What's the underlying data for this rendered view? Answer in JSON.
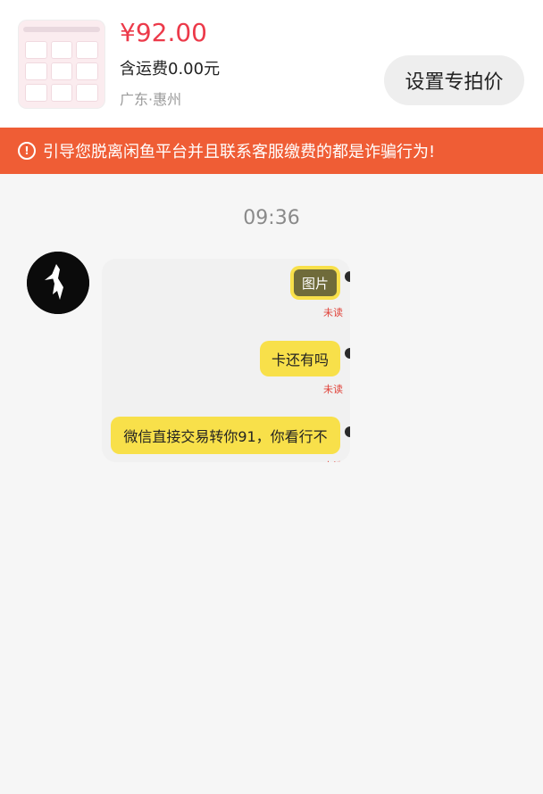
{
  "product": {
    "price": "¥92.00",
    "shipping": "含运费0.00元",
    "location": "广东·惠州",
    "set_price_label": "设置专拍价"
  },
  "warning": {
    "text": "引导您脱离闲鱼平台并且联系客服缴费的都是诈骗行为!"
  },
  "chat": {
    "timestamp": "09:36",
    "messages": [
      {
        "type": "image",
        "label": "图片",
        "status": "未读"
      },
      {
        "type": "text",
        "text": "卡还有吗",
        "status": "未读"
      },
      {
        "type": "text",
        "text": "微信直接交易转你91，你看行不",
        "status": "未读"
      }
    ]
  },
  "colors": {
    "price": "#ec3a4a",
    "banner": "#ef5d35",
    "bubble": "#f8e04a",
    "unread": "#e0433a"
  }
}
